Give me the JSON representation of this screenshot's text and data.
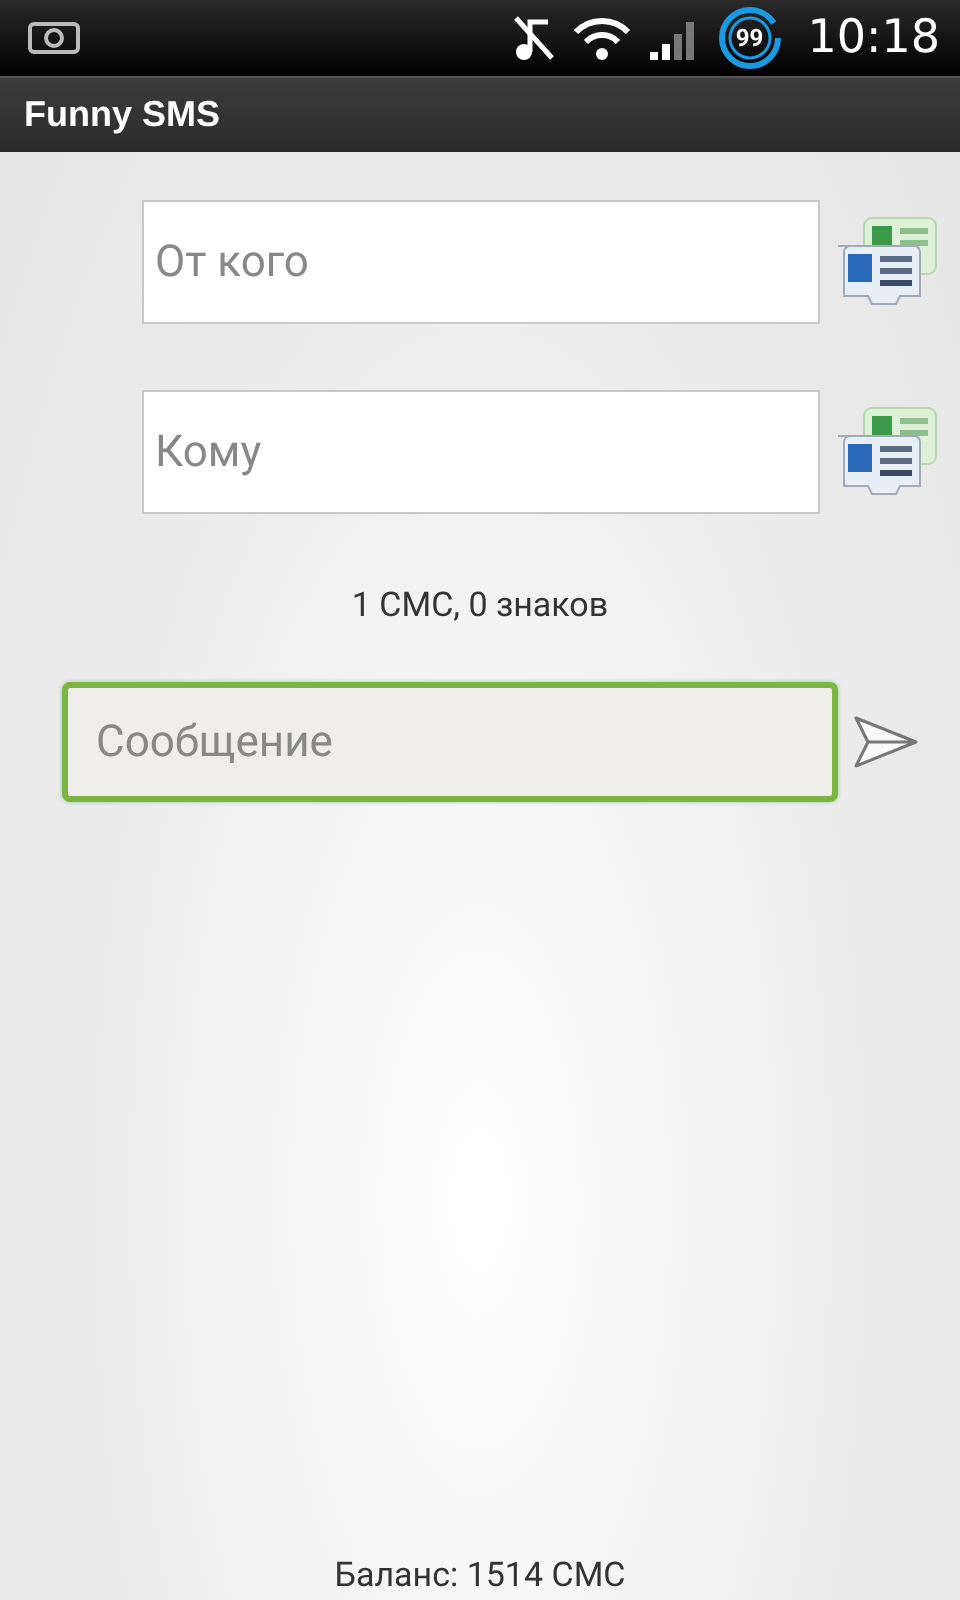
{
  "status_bar": {
    "battery": "99",
    "time": "10:18"
  },
  "title": "Funny SMS",
  "recipients": [
    {
      "placeholder": "От кого"
    },
    {
      "placeholder": "Кому"
    }
  ],
  "counter": "1 СМС, 0 знаков",
  "message": {
    "placeholder": "Сообщение",
    "focused": true
  },
  "balance": "Баланс: 1514 СМС"
}
